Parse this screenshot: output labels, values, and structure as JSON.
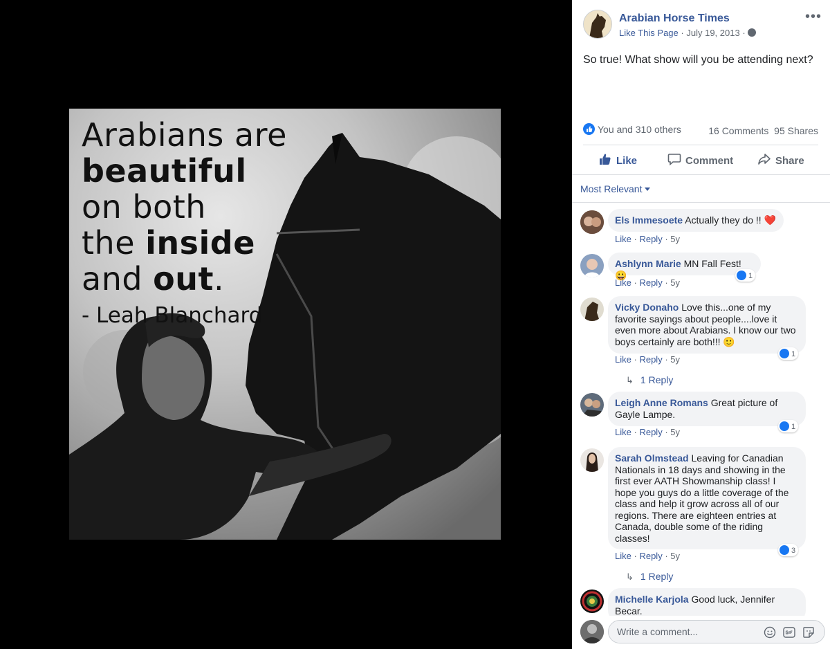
{
  "image_quote": {
    "line1": "Arabians are",
    "line2": "beautiful",
    "line3": "on both",
    "line4a": "the ",
    "line4b": "inside",
    "line5a": "and ",
    "line5b": "out",
    "line5c": ".",
    "attribution": "- Leah Blanchard"
  },
  "post": {
    "page_name": "Arabian Horse Times",
    "like_page": "Like This Page",
    "date": "July 19, 2013",
    "separator": "·",
    "text": "So true! What show will you be attending next?",
    "reactions_text": "You and 310 others",
    "comments_count": "16 Comments",
    "shares_count": "95 Shares",
    "actions": {
      "like": "Like",
      "comment": "Comment",
      "share": "Share"
    },
    "more_icon": "more-dots-icon",
    "privacy_icon": "globe-icon"
  },
  "sort_label": "Most Relevant",
  "comments": [
    {
      "author": "Els Immesoete",
      "text": "Actually they do !!",
      "emoji": "❤️",
      "like": "Like",
      "reply": "Reply",
      "time": "5y"
    },
    {
      "author": "Ashlynn Marie",
      "text": "MN Fall Fest!",
      "emoji": "😀",
      "like": "Like",
      "reply": "Reply",
      "time": "5y",
      "reactions": "1"
    },
    {
      "author": "Vicky Donaho",
      "text": "Love this...one of my favorite sayings about people....love it even more about Arabians. I know our two boys certainly are both!!!",
      "emoji": "🙂",
      "like": "Like",
      "reply": "Reply",
      "time": "5y",
      "reactions": "1",
      "replies": "1 Reply"
    },
    {
      "author": "Leigh Anne Romans",
      "text": "Great picture of Gayle Lampe.",
      "like": "Like",
      "reply": "Reply",
      "time": "5y",
      "reactions": "1"
    },
    {
      "author": "Sarah Olmstead",
      "text": "Leaving for Canadian Nationals in 18 days and showing in the first ever AATH Showmanship class! I hope you guys do a little coverage of the class and help it grow across all of our regions. There are eighteen entries at Canada, double some of the riding classes!",
      "like": "Like",
      "reply": "Reply",
      "time": "5y",
      "reactions": "3",
      "replies": "1 Reply"
    },
    {
      "author": "Michelle Karjola",
      "text": "Good luck, Jennifer Becar."
    }
  ],
  "composer": {
    "placeholder": "Write a comment...",
    "icons": [
      "emoji-icon",
      "gif-icon",
      "sticker-icon"
    ]
  },
  "colors": {
    "link_blue": "#385898",
    "like_blue": "#1877f2",
    "bubble_gray": "#f2f3f5",
    "meta_gray": "#606770"
  }
}
